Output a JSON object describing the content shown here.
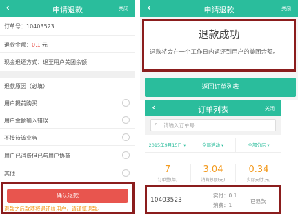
{
  "left_screen": {
    "nav": {
      "back_icon": "chevron-left-icon",
      "title": "申请退款",
      "close": "关闭"
    },
    "order_no": "订单号：10403523",
    "refund_amount_label": "退款金额：",
    "refund_amount_value": "0.1",
    "refund_amount_unit": "元",
    "refund_method": "现金退还方式：退至用户美团余额",
    "reason_header": "退款原因（必填）",
    "reasons": [
      "用户提前购买",
      "用户金额输入错误",
      "不接待该业务",
      "用户已消费但已与用户协商",
      "其他"
    ],
    "confirm_button": "确认退款",
    "warning": "退款之后款项将退还给用户，请谨慎退款。"
  },
  "right_top": {
    "nav": {
      "back_icon": "chevron-left-icon",
      "title": "申请退款",
      "close": "关闭"
    },
    "success_title": "退款成功",
    "success_message": "退款将会在一个工作日内返还到用户的美团余额。",
    "return_button": "返回订单列表"
  },
  "right_bottom": {
    "nav": {
      "back_icon": "chevron-left-icon",
      "title": "订单列表",
      "close": "关闭"
    },
    "search": {
      "icon": "search-icon",
      "placeholder": "请输入订单号"
    },
    "filters": [
      {
        "label": "2015年9月15日",
        "icon": "caret-down-icon"
      },
      {
        "label": "全部活动",
        "icon": "caret-down-icon"
      },
      {
        "label": "全部分店",
        "icon": "caret-down-icon"
      }
    ],
    "stats": [
      {
        "value": "7",
        "label": "订单量(单)"
      },
      {
        "value": "3.04",
        "label": "消费总额(元)"
      },
      {
        "value": "0.34",
        "label": "实际支付(元)"
      }
    ],
    "order": {
      "id": "10403523",
      "paid_label": "实付：",
      "paid_value": "0.1",
      "consumed_label": "消费：",
      "consumed_value": "1",
      "status": "已退款"
    }
  },
  "colors": {
    "brand": "#2abd9c",
    "red": "#e8554e",
    "highlight": "#8b1d1d",
    "orange": "#f39a1e"
  }
}
